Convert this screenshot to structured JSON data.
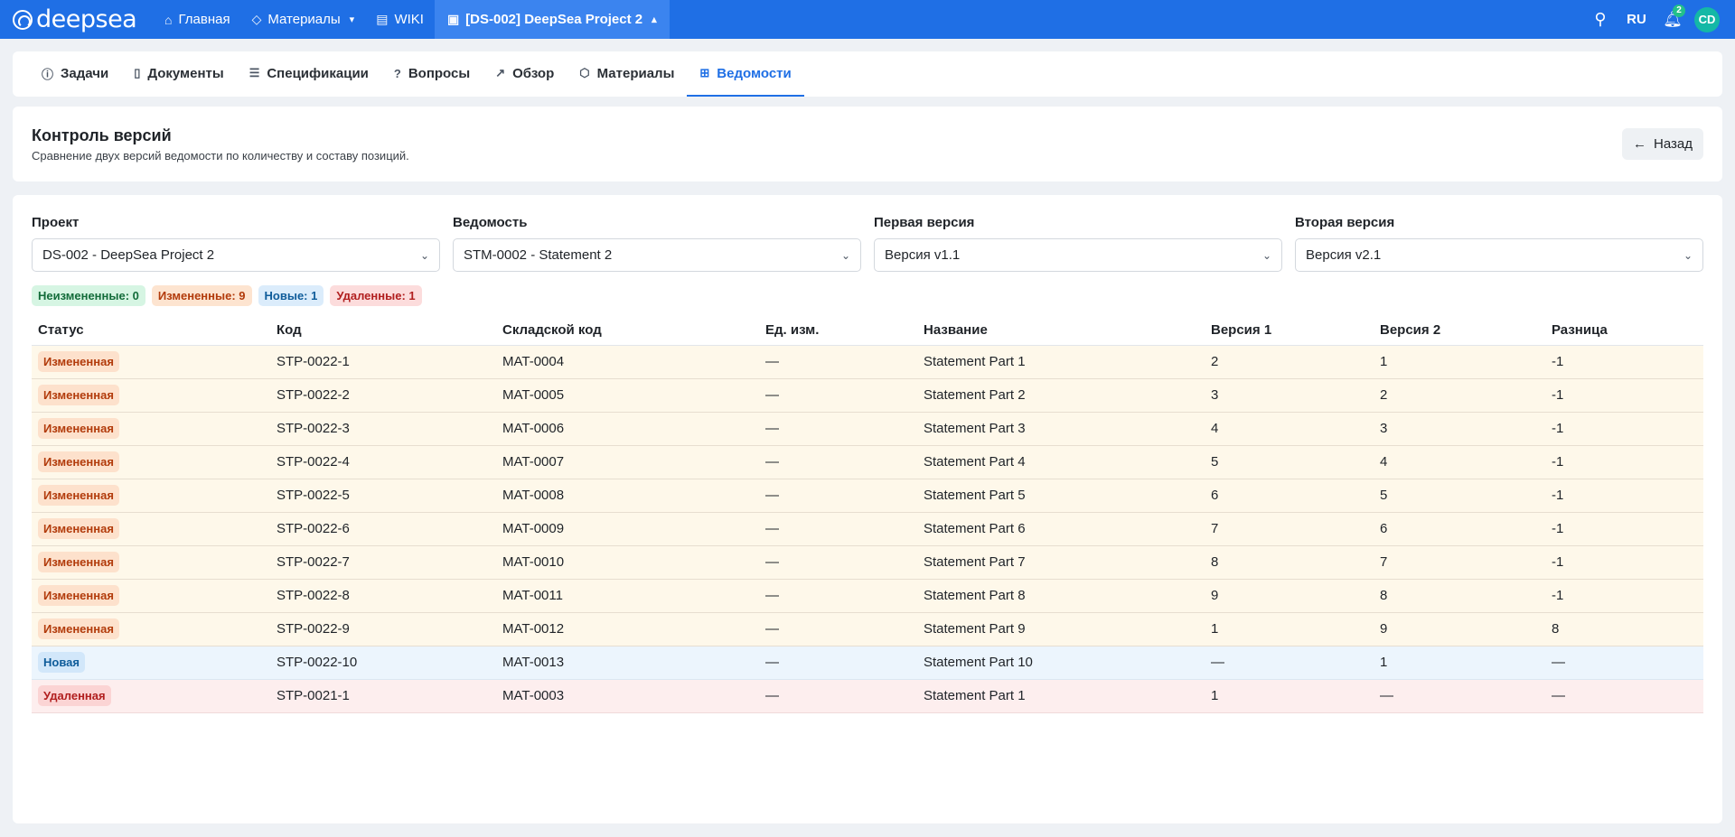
{
  "navbar": {
    "logo_text": "deepsea",
    "items": [
      {
        "label": "Главная",
        "icon": "home-icon"
      },
      {
        "label": "Материалы",
        "icon": "tag-icon"
      },
      {
        "label": "WIKI",
        "icon": "book-icon"
      },
      {
        "label": "[DS-002] DeepSea Project 2",
        "icon": "briefcase-icon"
      }
    ],
    "lang": "RU",
    "notifications_count": "2",
    "avatar_initials": "CD"
  },
  "tabs": [
    {
      "label": "Задачи",
      "icon": "alert-circle-icon"
    },
    {
      "label": "Документы",
      "icon": "file-icon"
    },
    {
      "label": "Спецификации",
      "icon": "list-icon"
    },
    {
      "label": "Вопросы",
      "icon": "help-circle-icon"
    },
    {
      "label": "Обзор",
      "icon": "chart-icon"
    },
    {
      "label": "Материалы",
      "icon": "box-icon"
    },
    {
      "label": "Ведомости",
      "icon": "grid-icon"
    }
  ],
  "active_tab": "Ведомости",
  "header": {
    "title": "Контроль версий",
    "subtitle": "Сравнение двух версий ведомости по количеству и составу позиций.",
    "back_label": "Назад"
  },
  "filters": [
    {
      "label": "Проект",
      "value": "DS-002 - DeepSea Project 2"
    },
    {
      "label": "Ведомость",
      "value": "STM-0002 - Statement 2"
    },
    {
      "label": "Первая версия",
      "value": "Версия v1.1"
    },
    {
      "label": "Вторая версия",
      "value": "Версия v2.1"
    }
  ],
  "summary": {
    "unchanged": "Неизмененные: 0",
    "changed": "Измененные: 9",
    "new": "Новые: 1",
    "deleted": "Удаленные: 1"
  },
  "table": {
    "columns": [
      "Статус",
      "Код",
      "Складской код",
      "Ед. изм.",
      "Название",
      "Версия 1",
      "Версия 2",
      "Разница"
    ],
    "rows": [
      {
        "status": "Измененная",
        "kind": "changed",
        "code": "STP-0022-1",
        "stock": "MAT-0004",
        "unit": "—",
        "name": "Statement Part 1",
        "v1": "2",
        "v2": "1",
        "diff": "-1"
      },
      {
        "status": "Измененная",
        "kind": "changed",
        "code": "STP-0022-2",
        "stock": "MAT-0005",
        "unit": "—",
        "name": "Statement Part 2",
        "v1": "3",
        "v2": "2",
        "diff": "-1"
      },
      {
        "status": "Измененная",
        "kind": "changed",
        "code": "STP-0022-3",
        "stock": "MAT-0006",
        "unit": "—",
        "name": "Statement Part 3",
        "v1": "4",
        "v2": "3",
        "diff": "-1"
      },
      {
        "status": "Измененная",
        "kind": "changed",
        "code": "STP-0022-4",
        "stock": "MAT-0007",
        "unit": "—",
        "name": "Statement Part 4",
        "v1": "5",
        "v2": "4",
        "diff": "-1"
      },
      {
        "status": "Измененная",
        "kind": "changed",
        "code": "STP-0022-5",
        "stock": "MAT-0008",
        "unit": "—",
        "name": "Statement Part 5",
        "v1": "6",
        "v2": "5",
        "diff": "-1"
      },
      {
        "status": "Измененная",
        "kind": "changed",
        "code": "STP-0022-6",
        "stock": "MAT-0009",
        "unit": "—",
        "name": "Statement Part 6",
        "v1": "7",
        "v2": "6",
        "diff": "-1"
      },
      {
        "status": "Измененная",
        "kind": "changed",
        "code": "STP-0022-7",
        "stock": "MAT-0010",
        "unit": "—",
        "name": "Statement Part 7",
        "v1": "8",
        "v2": "7",
        "diff": "-1"
      },
      {
        "status": "Измененная",
        "kind": "changed",
        "code": "STP-0022-8",
        "stock": "MAT-0011",
        "unit": "—",
        "name": "Statement Part 8",
        "v1": "9",
        "v2": "8",
        "diff": "-1"
      },
      {
        "status": "Измененная",
        "kind": "changed",
        "code": "STP-0022-9",
        "stock": "MAT-0012",
        "unit": "—",
        "name": "Statement Part 9",
        "v1": "1",
        "v2": "9",
        "diff": "8"
      },
      {
        "status": "Новая",
        "kind": "new",
        "code": "STP-0022-10",
        "stock": "MAT-0013",
        "unit": "—",
        "name": "Statement Part 10",
        "v1": "—",
        "v2": "1",
        "diff": "—"
      },
      {
        "status": "Удаленная",
        "kind": "deleted",
        "code": "STP-0021-1",
        "stock": "MAT-0003",
        "unit": "—",
        "name": "Statement Part 1",
        "v1": "1",
        "v2": "—",
        "diff": "—"
      }
    ]
  }
}
